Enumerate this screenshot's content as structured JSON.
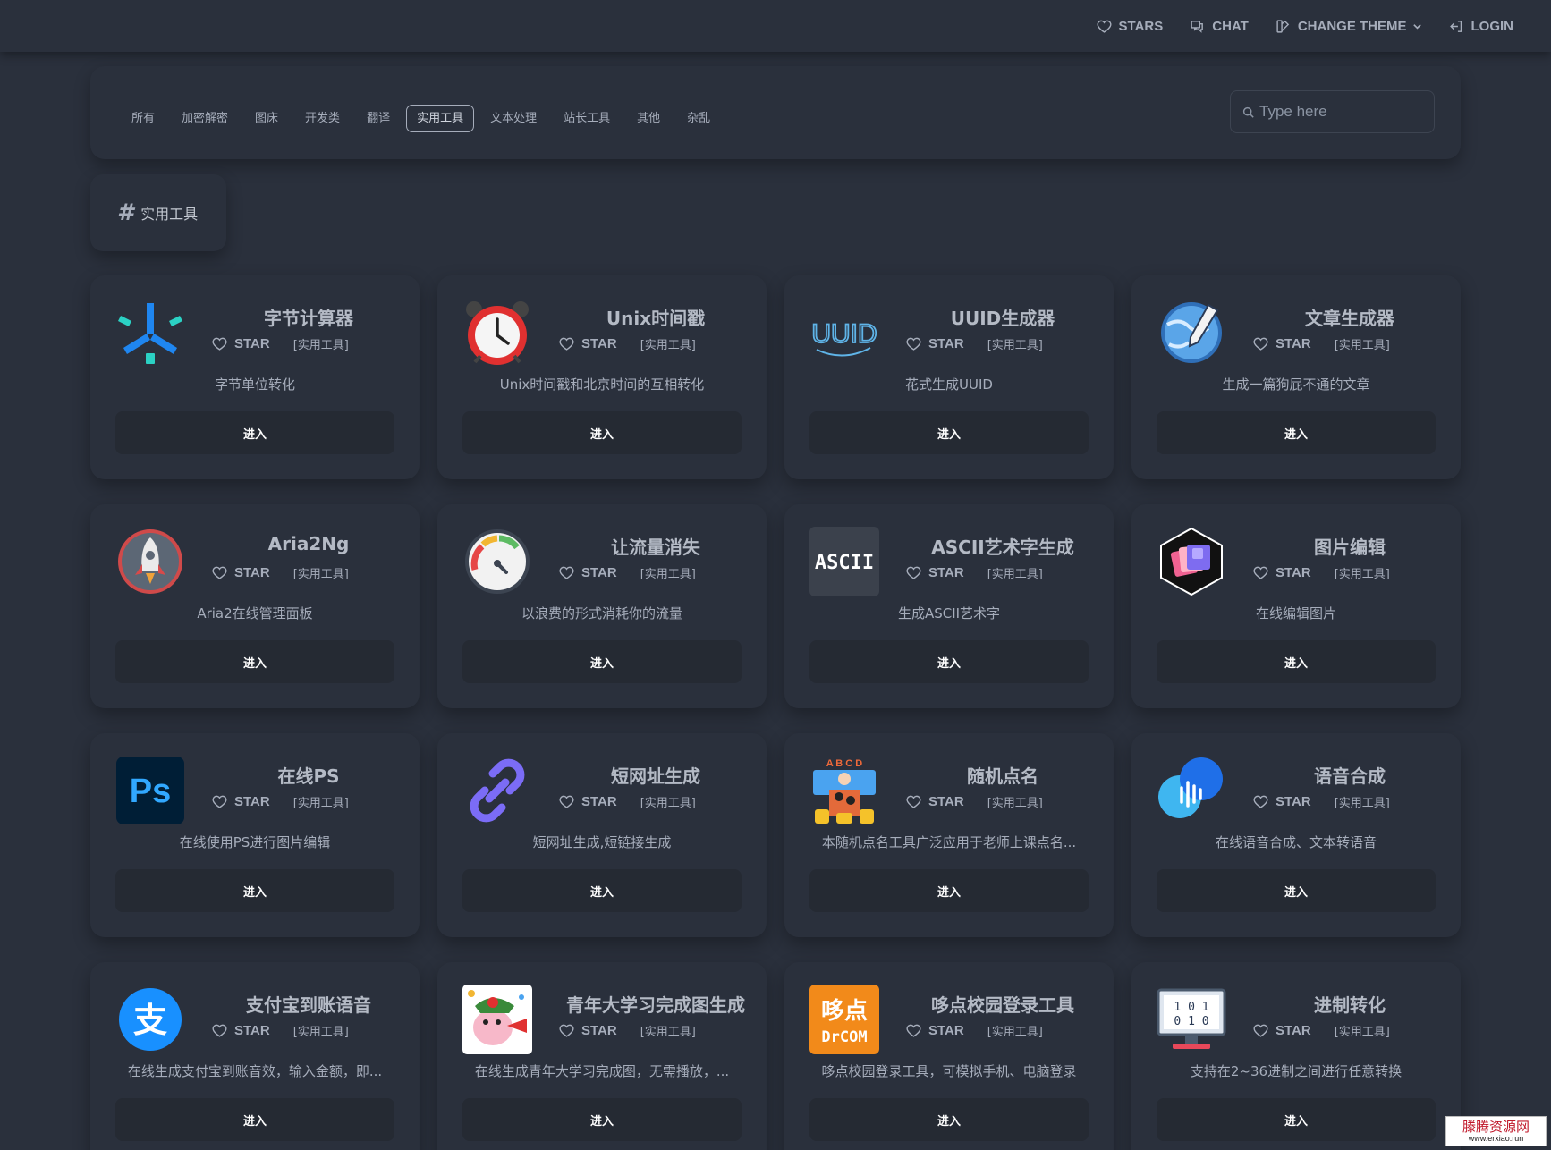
{
  "navbar": {
    "stars_label": "STARS",
    "chat_label": "CHAT",
    "theme_label": "CHANGE THEME",
    "login_label": "LOGIN"
  },
  "categories": [
    {
      "label": "所有",
      "active": false
    },
    {
      "label": "加密解密",
      "active": false
    },
    {
      "label": "图床",
      "active": false
    },
    {
      "label": "开发类",
      "active": false
    },
    {
      "label": "翻译",
      "active": false
    },
    {
      "label": "实用工具",
      "active": true
    },
    {
      "label": "文本处理",
      "active": false
    },
    {
      "label": "站长工具",
      "active": false
    },
    {
      "label": "其他",
      "active": false
    },
    {
      "label": "杂乱",
      "active": false
    }
  ],
  "search": {
    "placeholder": "Type here"
  },
  "section": {
    "hash": "#",
    "label": "实用工具"
  },
  "card_common": {
    "star_label": "STAR",
    "tag": "[实用工具]",
    "enter_label": "进入"
  },
  "cards": [
    {
      "title": "字节计算器",
      "desc": "字节单位转化",
      "icon": "byte-calculator-icon"
    },
    {
      "title": "Unix时间戳",
      "desc": "Unix时间戳和北京时间的互相转化",
      "icon": "alarm-clock-icon"
    },
    {
      "title": "UUID生成器",
      "desc": "花式生成UUID",
      "icon": "uuid-icon"
    },
    {
      "title": "文章生成器",
      "desc": "生成一篇狗屁不通的文章",
      "icon": "globe-pencil-icon"
    },
    {
      "title": "Aria2Ng",
      "desc": "Aria2在线管理面板",
      "icon": "rocket-icon"
    },
    {
      "title": "让流量消失",
      "desc": "以浪费的形式消耗你的流量",
      "icon": "gauge-icon"
    },
    {
      "title": "ASCII艺术字生成",
      "desc": "生成ASCII艺术字",
      "icon": "ascii-icon"
    },
    {
      "title": "图片编辑",
      "desc": "在线编辑图片",
      "icon": "image-edit-icon"
    },
    {
      "title": "在线PS",
      "desc": "在线使用PS进行图片编辑",
      "icon": "photoshop-icon"
    },
    {
      "title": "短网址生成",
      "desc": "短网址生成,短链接生成",
      "icon": "link-icon"
    },
    {
      "title": "随机点名",
      "desc": "本随机点名工具广泛应用于老师上课点名...",
      "icon": "roll-call-icon"
    },
    {
      "title": "语音合成",
      "desc": "在线语音合成、文本转语音",
      "icon": "voice-icon"
    },
    {
      "title": "支付宝到账语音",
      "desc": "在线生成支付宝到账音效，输入金额，即...",
      "icon": "alipay-icon"
    },
    {
      "title": "青年大学习完成图生成",
      "desc": "在线生成青年大学习完成图，无需播放，...",
      "icon": "cartoon-icon"
    },
    {
      "title": "哆点校园登录工具",
      "desc": "哆点校园登录工具，可模拟手机、电脑登录",
      "icon": "drcom-icon"
    },
    {
      "title": "进制转化",
      "desc": "支持在2~36进制之间进行任意转换",
      "icon": "binary-monitor-icon"
    }
  ],
  "icon_text": {
    "uuid": "UUID",
    "ascii": "ASCII",
    "ps": "Ps",
    "alipay": "支",
    "drcom_top": "哆点",
    "drcom_bottom": "DrCOM",
    "binary_row1": "1 0 1",
    "binary_row2": "0 1 0",
    "roll_call_letters": "A B C D"
  },
  "watermark": {
    "top": "滕腾资源网",
    "bottom": "www.erxiao.run"
  }
}
